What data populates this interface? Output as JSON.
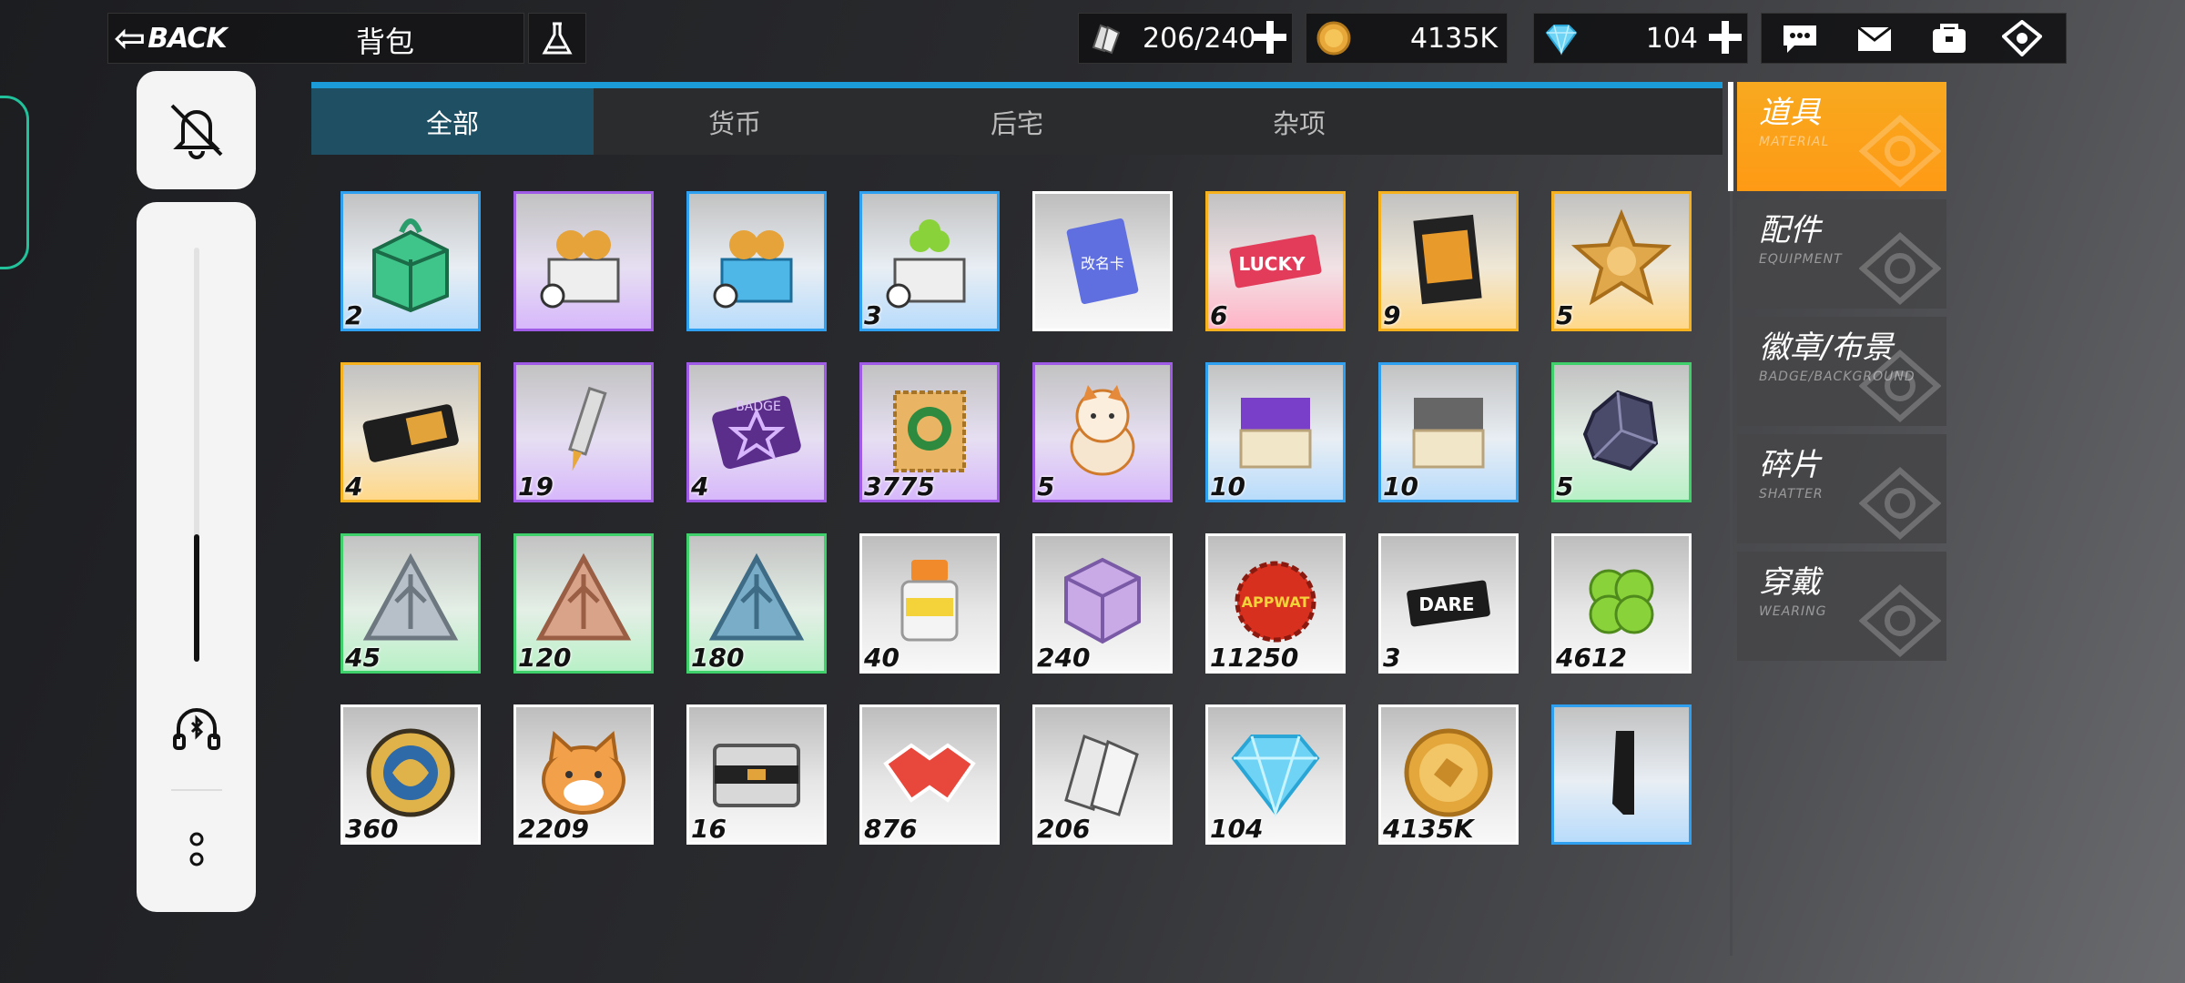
{
  "header": {
    "back_label": "BACK",
    "title": "背包",
    "stamina": "206/240",
    "coins": "4135K",
    "gems": "104",
    "menu_icons": [
      "chat-icon",
      "mail-icon",
      "bag-icon",
      "home-icon"
    ]
  },
  "tabs": [
    {
      "label": "全部",
      "active": true
    },
    {
      "label": "货币",
      "active": false
    },
    {
      "label": "后宅",
      "active": false
    },
    {
      "label": "杂项",
      "active": false
    }
  ],
  "categories": [
    {
      "name": "道具",
      "en": "MATERIAL",
      "active": true
    },
    {
      "name": "配件",
      "en": "EQUIPMENT",
      "active": false
    },
    {
      "name": "徽章/布景",
      "en": "BADGE/BACKGROUND",
      "active": false
    },
    {
      "name": "碎片",
      "en": "SHATTER",
      "active": false
    },
    {
      "name": "穿戴",
      "en": "WEARING",
      "active": false
    }
  ],
  "items": [
    {
      "count": "2",
      "rarity": "blue",
      "icon": "green-gift-box-icon"
    },
    {
      "count": "",
      "rarity": "purple",
      "icon": "coin-box-timed-icon"
    },
    {
      "count": "",
      "rarity": "blue",
      "icon": "blue-coin-box-timed-icon"
    },
    {
      "count": "3",
      "rarity": "blue",
      "icon": "clover-box-timed-icon"
    },
    {
      "count": "",
      "rarity": "white",
      "icon": "rename-card-icon",
      "label": "改名卡"
    },
    {
      "count": "6",
      "rarity": "pink",
      "icon": "lucky-ticket-icon",
      "label": "LUCKY"
    },
    {
      "count": "9",
      "rarity": "gold",
      "icon": "magazine-icon"
    },
    {
      "count": "5",
      "rarity": "gold",
      "icon": "gold-star-medal-icon"
    },
    {
      "count": "4",
      "rarity": "gold",
      "icon": "gold-ticket-icon"
    },
    {
      "count": "19",
      "rarity": "purple",
      "icon": "tube-icon"
    },
    {
      "count": "4",
      "rarity": "purple",
      "icon": "badge-scroll-icon",
      "label": "BADGE"
    },
    {
      "count": "3775",
      "rarity": "purple",
      "icon": "stamp-icon"
    },
    {
      "count": "5",
      "rarity": "purple",
      "icon": "lucky-cat-icon"
    },
    {
      "count": "10",
      "rarity": "blue",
      "icon": "purple-eraser-icon"
    },
    {
      "count": "10",
      "rarity": "blue",
      "icon": "gray-eraser-icon"
    },
    {
      "count": "5",
      "rarity": "green",
      "icon": "dark-crystal-icon"
    },
    {
      "count": "45",
      "rarity": "green",
      "icon": "silver-triangle-emblem-icon"
    },
    {
      "count": "120",
      "rarity": "green",
      "icon": "bronze-triangle-emblem-icon"
    },
    {
      "count": "180",
      "rarity": "green",
      "icon": "blue-triangle-emblem-icon"
    },
    {
      "count": "40",
      "rarity": "white",
      "icon": "paint-bottle-icon"
    },
    {
      "count": "240",
      "rarity": "white",
      "icon": "cube-icon"
    },
    {
      "count": "11250",
      "rarity": "white",
      "icon": "bottle-cap-icon",
      "label": "APPWAT"
    },
    {
      "count": "3",
      "rarity": "white",
      "icon": "dare-ticket-icon",
      "label": "DARE"
    },
    {
      "count": "4612",
      "rarity": "white",
      "icon": "clover-icon"
    },
    {
      "count": "360",
      "rarity": "white",
      "icon": "emblem-coin-icon"
    },
    {
      "count": "2209",
      "rarity": "white",
      "icon": "cat-head-icon"
    },
    {
      "count": "16",
      "rarity": "white",
      "icon": "metal-case-icon"
    },
    {
      "count": "876",
      "rarity": "white",
      "icon": "handshake-icon"
    },
    {
      "count": "206",
      "rarity": "white",
      "icon": "stamina-cards-icon"
    },
    {
      "count": "104",
      "rarity": "white",
      "icon": "diamond-icon"
    },
    {
      "count": "4135K",
      "rarity": "white",
      "icon": "gold-coin-icon"
    },
    {
      "count": "",
      "rarity": "blue",
      "icon": "black-panel-icon"
    }
  ],
  "colors": {
    "accent": "#1c9bd9",
    "active_tab": "#1e4f63",
    "active_category": "#f7a91f"
  }
}
